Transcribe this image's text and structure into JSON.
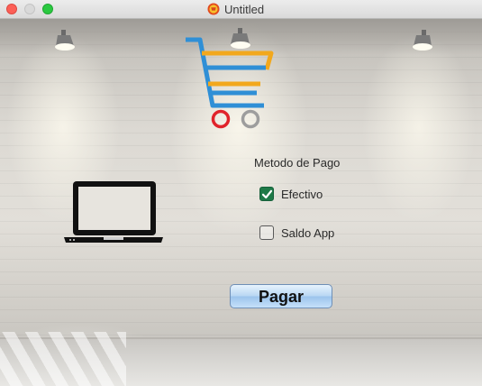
{
  "window": {
    "title": "Untitled",
    "app_icon": "app-badge-icon",
    "controls": [
      "close-dot",
      "minimize-dot",
      "maximize-dot"
    ]
  },
  "scene": {
    "background": "brick-wall-with-spotlights",
    "spotlights": 3,
    "logo": "shopping-cart-icon",
    "device": "laptop-icon"
  },
  "payment": {
    "label": "Metodo de Pago",
    "options": [
      {
        "label": "Efectivo",
        "checked": true
      },
      {
        "label": "Saldo App",
        "checked": false
      }
    ],
    "submit_label": "Pagar"
  },
  "colors": {
    "cart_blue": "#2f8fd6",
    "cart_orange": "#f2a81d",
    "wheel_red": "#e0232b",
    "wheel_gray": "#9d9d9d",
    "checkbox_green": "#1e7a47",
    "button_blue": "#9cc4ec"
  }
}
